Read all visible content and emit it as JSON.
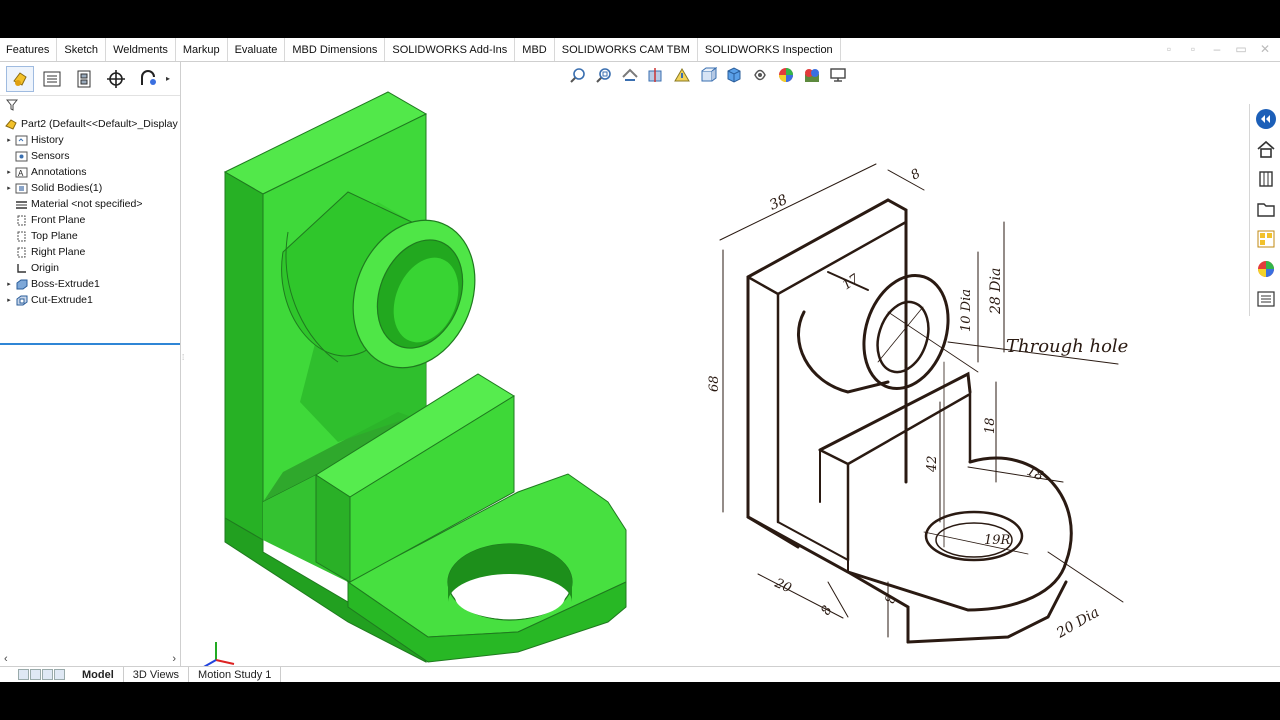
{
  "ribbon": {
    "tabs": [
      "Features",
      "Sketch",
      "Weldments",
      "Markup",
      "Evaluate",
      "MBD Dimensions",
      "SOLIDWORKS Add-Ins",
      "MBD",
      "SOLIDWORKS CAM TBM",
      "SOLIDWORKS Inspection"
    ]
  },
  "feature_tree": {
    "root": "Part2  (Default<<Default>_Display S",
    "items": [
      {
        "label": "History",
        "icon": "history-folder-icon",
        "expandable": true
      },
      {
        "label": "Sensors",
        "icon": "sensors-icon",
        "expandable": false
      },
      {
        "label": "Annotations",
        "icon": "annotations-icon",
        "expandable": true
      },
      {
        "label": "Solid Bodies(1)",
        "icon": "solid-bodies-icon",
        "expandable": true
      },
      {
        "label": "Material <not specified>",
        "icon": "material-icon",
        "expandable": false
      },
      {
        "label": "Front Plane",
        "icon": "plane-icon",
        "expandable": false
      },
      {
        "label": "Top Plane",
        "icon": "plane-icon",
        "expandable": false
      },
      {
        "label": "Right Plane",
        "icon": "plane-icon",
        "expandable": false
      },
      {
        "label": "Origin",
        "icon": "origin-icon",
        "expandable": false
      },
      {
        "label": "Boss-Extrude1",
        "icon": "extrude-icon",
        "expandable": true
      },
      {
        "label": "Cut-Extrude1",
        "icon": "cut-extrude-icon",
        "expandable": true
      }
    ]
  },
  "bottom_tabs": {
    "model": "Model",
    "views3d": "3D Views",
    "motion": "Motion Study 1"
  },
  "drawing": {
    "dim_38": "38",
    "dim_8_top": "8",
    "dim_17": "17",
    "dim_10dia": "10 Dia",
    "dim_28dia": "28 Dia",
    "through_hole": "Through hole",
    "dim_68": "68",
    "dim_18_vert": "18",
    "dim_42": "42",
    "dim_18_horiz": "18",
    "dim_19r": "19R",
    "dim_20": "20",
    "dim_8_bottom": "8",
    "dim_8_base": "8",
    "dim_20dia": "20 Dia"
  },
  "colors": {
    "model_green": "#3fdc3a",
    "model_dark": "#1f9a1f",
    "accent_blue": "#2f86d6"
  }
}
